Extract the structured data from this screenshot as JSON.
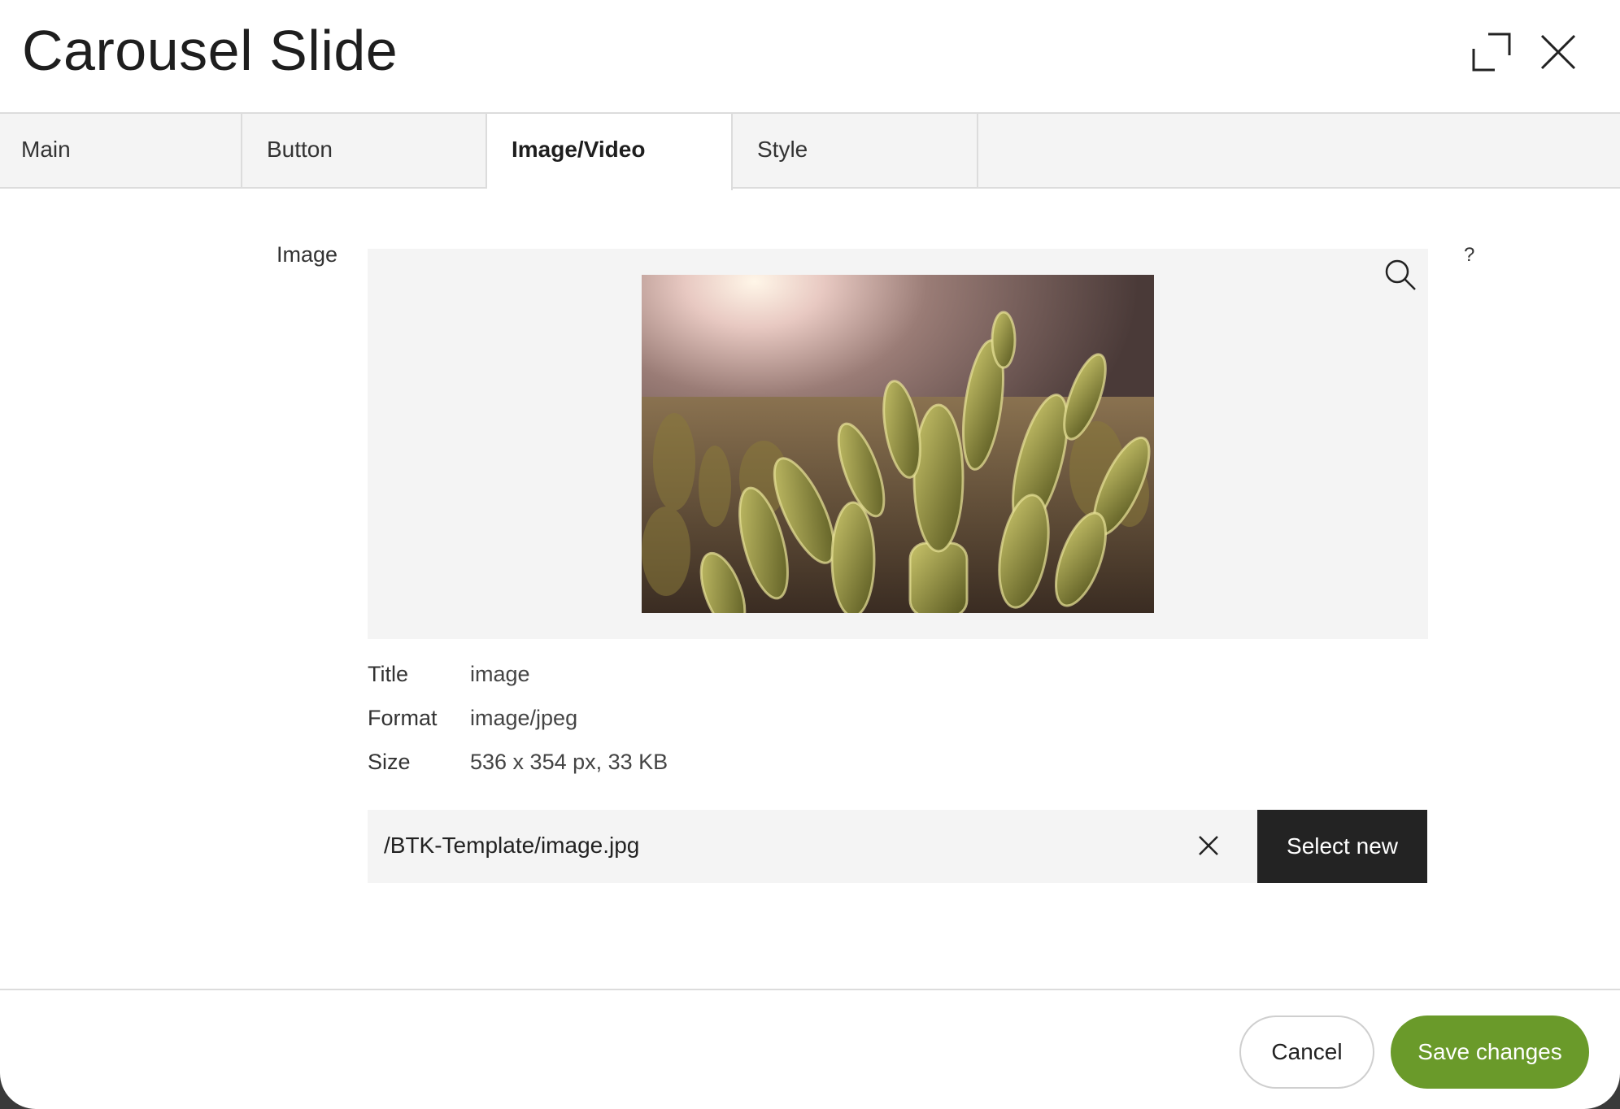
{
  "dialog": {
    "title": "Carousel Slide"
  },
  "header_icons": {
    "expand": "expand-icon",
    "close": "close-icon"
  },
  "tabs": [
    {
      "label": "Main",
      "active": false
    },
    {
      "label": "Button",
      "active": false
    },
    {
      "label": "Image/Video",
      "active": true
    },
    {
      "label": "Style",
      "active": false
    }
  ],
  "image_field": {
    "label": "Image",
    "help": "?",
    "zoom_icon": "search-icon",
    "thumbnail": "cactus photo",
    "meta": {
      "title_key": "Title",
      "title_value": "image",
      "format_key": "Format",
      "format_value": "image/jpeg",
      "size_key": "Size",
      "size_value": "536 x 354 px, 33 KB"
    },
    "path": "/BTK-Template/image.jpg",
    "clear_icon": "close-icon",
    "select_label": "Select new"
  },
  "footer": {
    "cancel_label": "Cancel",
    "save_label": "Save changes"
  },
  "colors": {
    "accent_green": "#6a9a2a",
    "dark_button": "#232323",
    "panel_gray": "#f4f4f4",
    "border_gray": "#dcdcdc"
  }
}
